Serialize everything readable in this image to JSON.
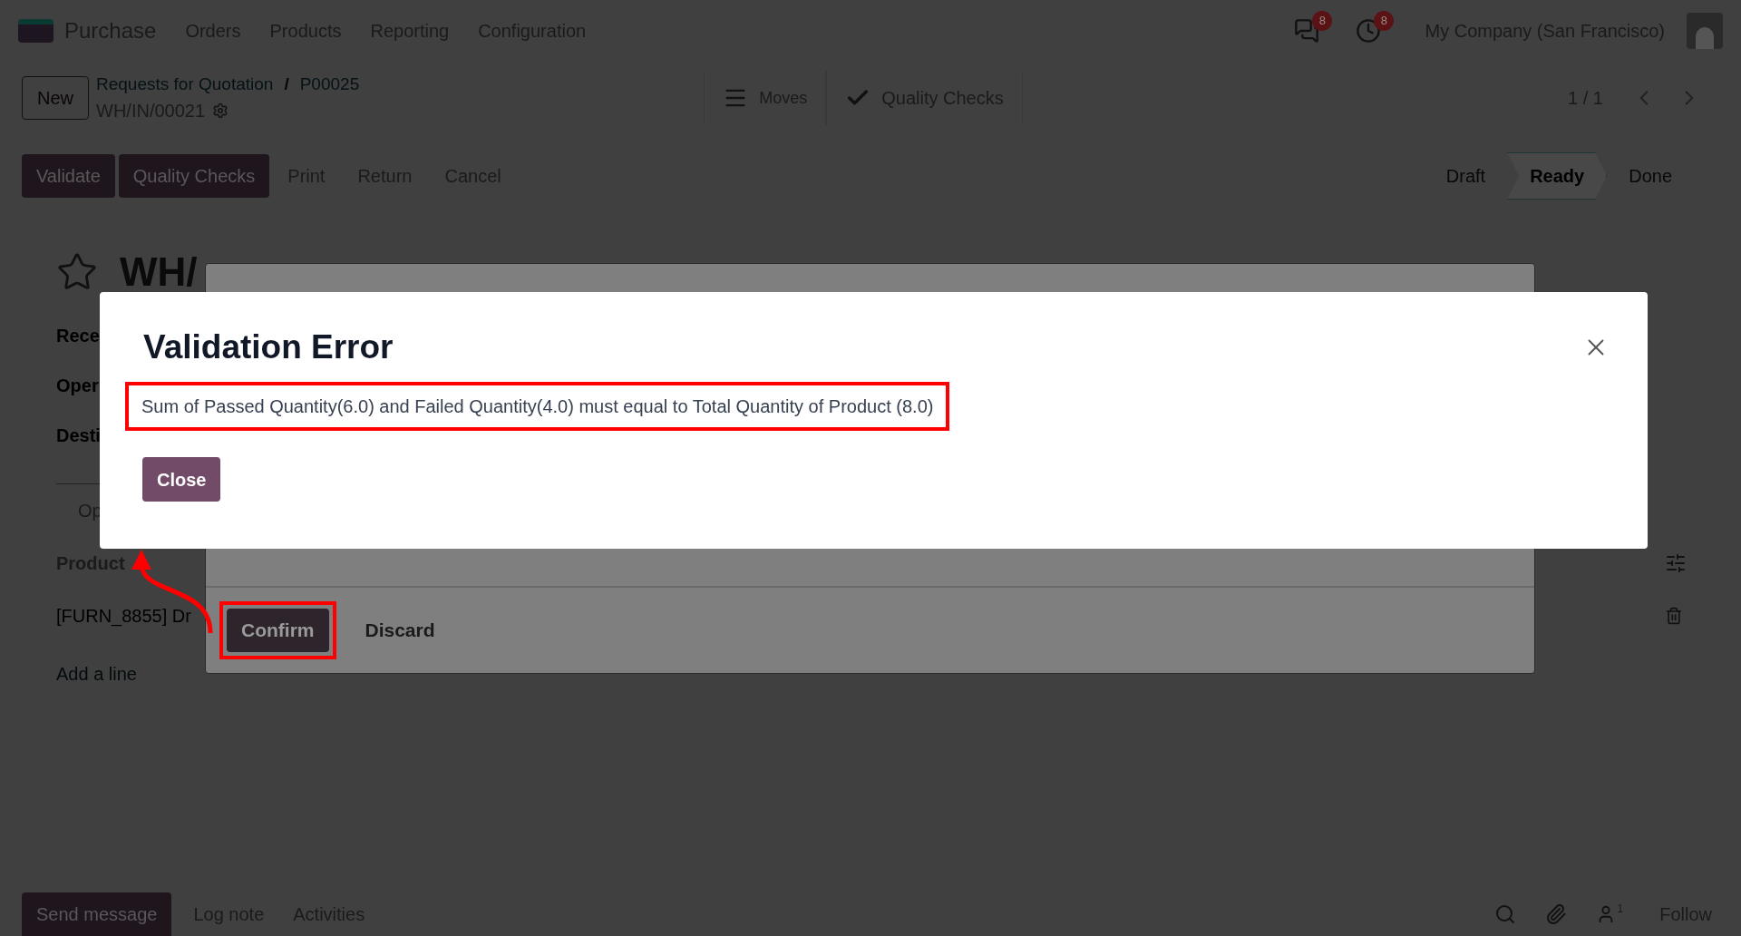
{
  "navbar": {
    "app": "Purchase",
    "menu": [
      "Orders",
      "Products",
      "Reporting",
      "Configuration"
    ],
    "messages_badge": "8",
    "activities_badge": "8",
    "company": "My Company (San Francisco)"
  },
  "control_panel": {
    "new_button": "New",
    "breadcrumbs": [
      "Requests for Quotation",
      "P00025"
    ],
    "breadcrumb_separator": "/",
    "record": "WH/IN/00021",
    "smart_buttons": [
      {
        "label": "Moves",
        "kind": "list"
      },
      {
        "label": "Quality Checks",
        "kind": "check"
      }
    ],
    "pager": "1 / 1"
  },
  "actions": [
    {
      "label": "Validate",
      "kind": "primary"
    },
    {
      "label": "Quality Checks",
      "kind": "primary"
    },
    {
      "label": "Print",
      "kind": "link"
    },
    {
      "label": "Return",
      "kind": "link"
    },
    {
      "label": "Cancel",
      "kind": "link"
    }
  ],
  "statusbar": [
    {
      "label": "Draft",
      "selected": false
    },
    {
      "label": "Ready",
      "selected": true
    },
    {
      "label": "Done",
      "selected": false
    }
  ],
  "form": {
    "title": "WH/",
    "fields": [
      "Rece",
      "Oper",
      "Desti"
    ],
    "tab": "Op",
    "column": "Product",
    "line": "[FURN_8855] Dr",
    "add_line": "Add a line"
  },
  "quality_dialog": {
    "buttons": [
      {
        "label": "Confirm",
        "kind": "primary",
        "highlighted": true
      },
      {
        "label": "Discard",
        "kind": "link",
        "highlighted": false
      }
    ]
  },
  "error_dialog": {
    "title": "Validation Error",
    "message": "Sum of Passed Quantity(6.0) and Failed Quantity(4.0) must equal to Total Quantity of Product (8.0)",
    "message_highlighted": true,
    "button": "Close"
  },
  "chatter": {
    "buttons": [
      {
        "label": "Send message",
        "kind": "primary"
      },
      {
        "label": "Log note",
        "kind": "link"
      },
      {
        "label": "Activities",
        "kind": "link"
      }
    ],
    "followers_count": "1",
    "follow": "Follow"
  }
}
